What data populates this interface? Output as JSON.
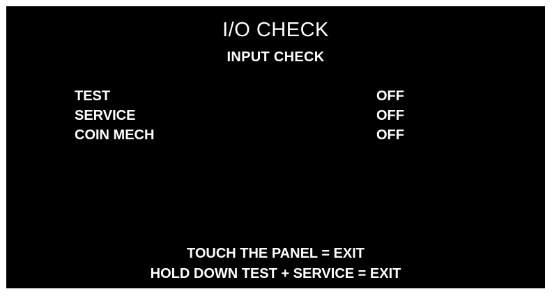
{
  "screen": {
    "title": "I/O CHECK",
    "subtitle": "INPUT CHECK",
    "inputs": [
      {
        "label": "TEST",
        "value": "OFF"
      },
      {
        "label": "SERVICE",
        "value": "OFF"
      },
      {
        "label": "COIN MECH",
        "value": "OFF"
      }
    ],
    "footer": [
      "TOUCH THE PANEL = EXIT",
      "HOLD DOWN TEST + SERVICE  = EXIT"
    ],
    "colors": {
      "background": "#000000",
      "text": "#ffffff"
    }
  }
}
